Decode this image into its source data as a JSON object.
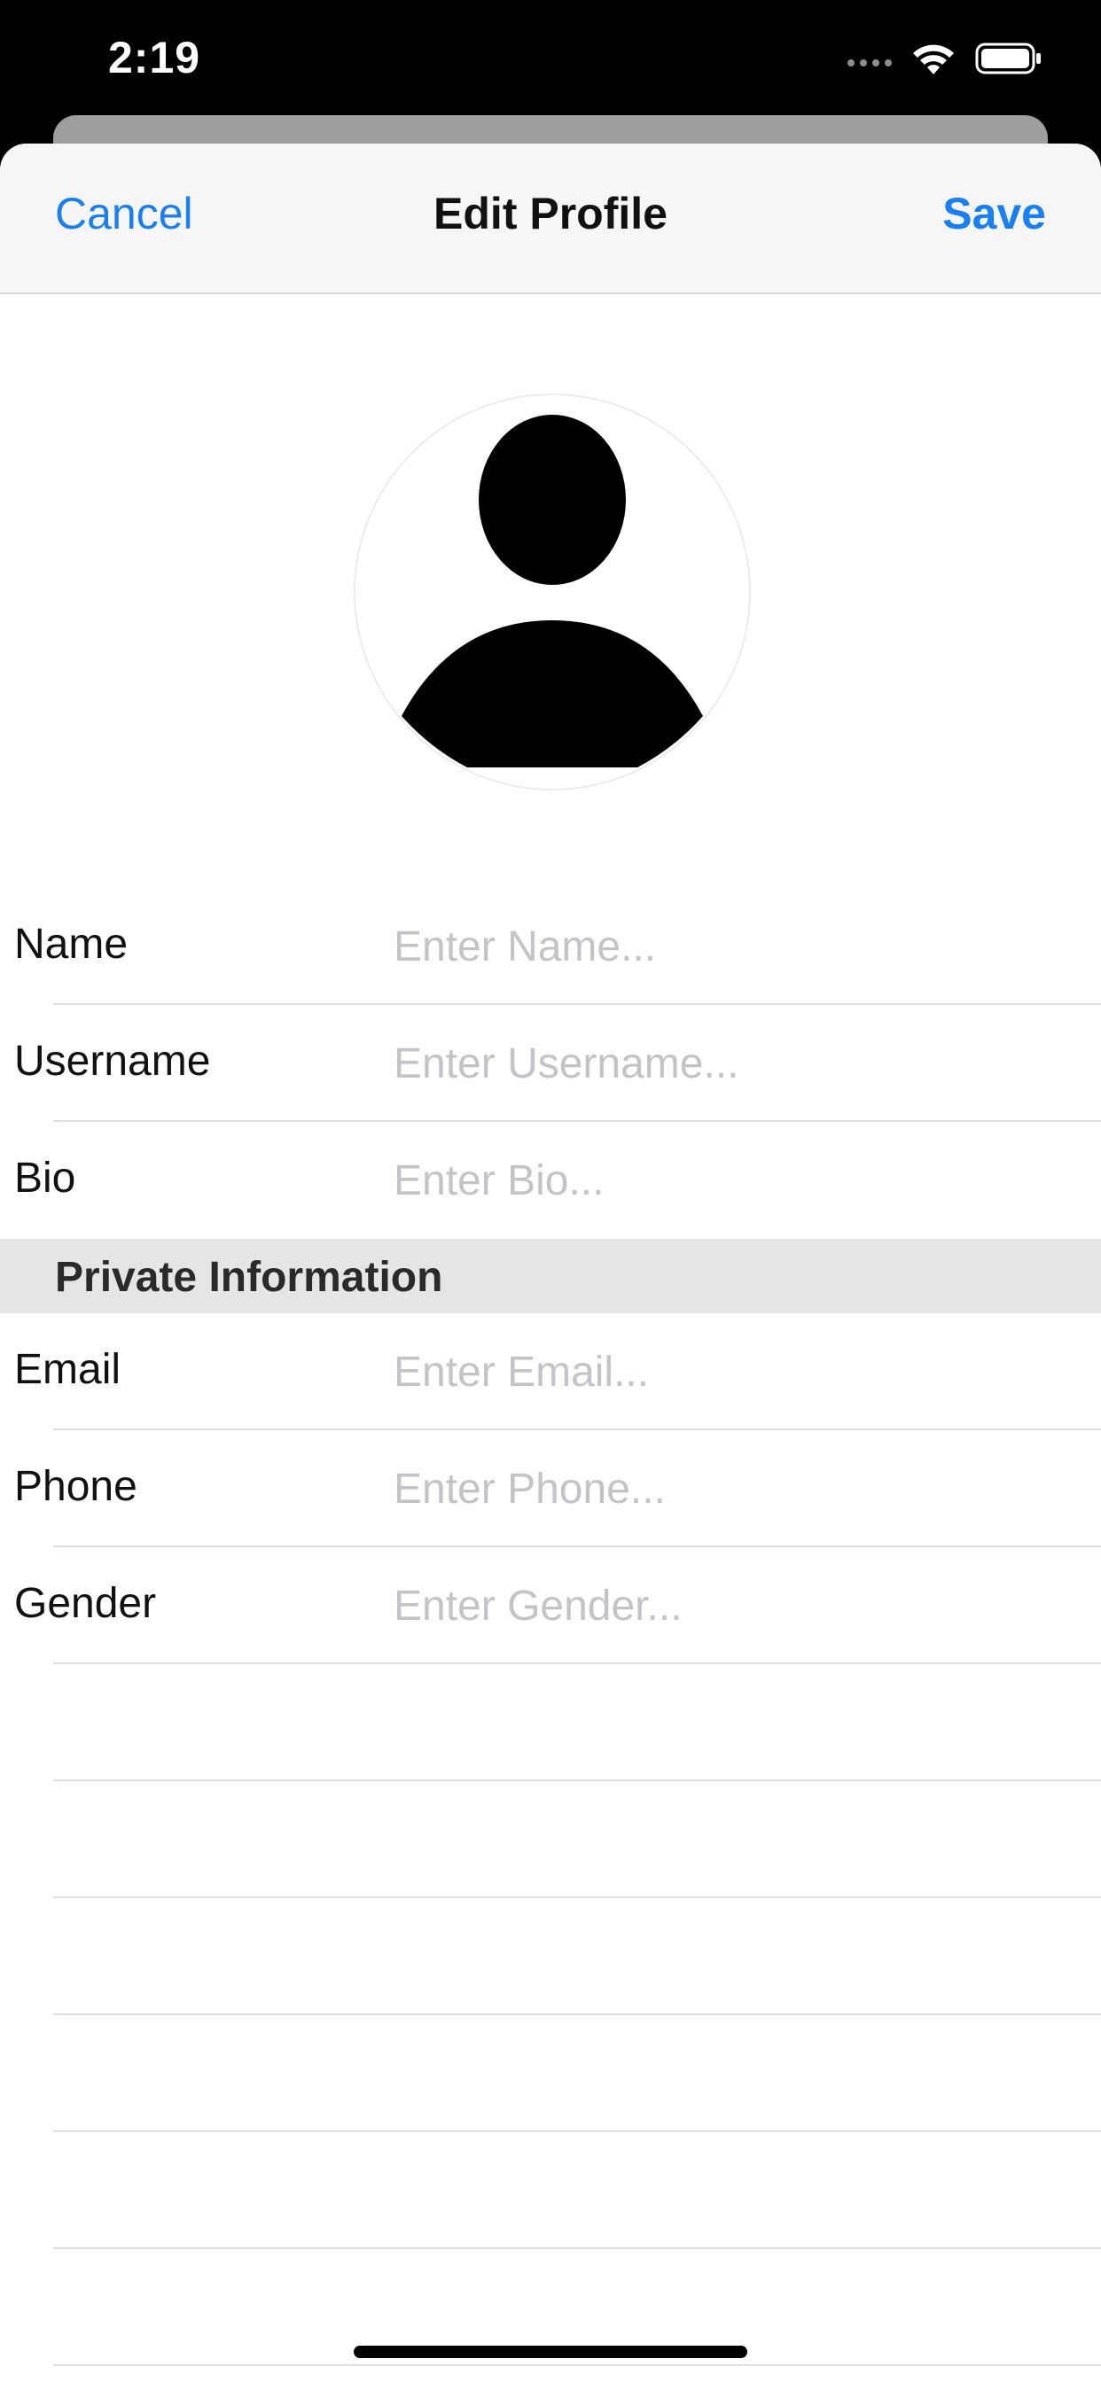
{
  "status_bar": {
    "time": "2:19"
  },
  "nav": {
    "cancel_label": "Cancel",
    "title": "Edit Profile",
    "save_label": "Save",
    "accent_color": "#1a7ff0"
  },
  "avatar": {
    "icon": "person-placeholder-icon"
  },
  "public_fields": [
    {
      "label": "Name",
      "placeholder": "Enter Name..."
    },
    {
      "label": "Username",
      "placeholder": "Enter Username..."
    },
    {
      "label": "Bio",
      "placeholder": "Enter Bio..."
    }
  ],
  "private_section": {
    "header": "Private Information",
    "fields": [
      {
        "label": "Email",
        "placeholder": "Enter Email..."
      },
      {
        "label": "Phone",
        "placeholder": "Enter Phone..."
      },
      {
        "label": "Gender",
        "placeholder": "Enter Gender..."
      }
    ]
  }
}
